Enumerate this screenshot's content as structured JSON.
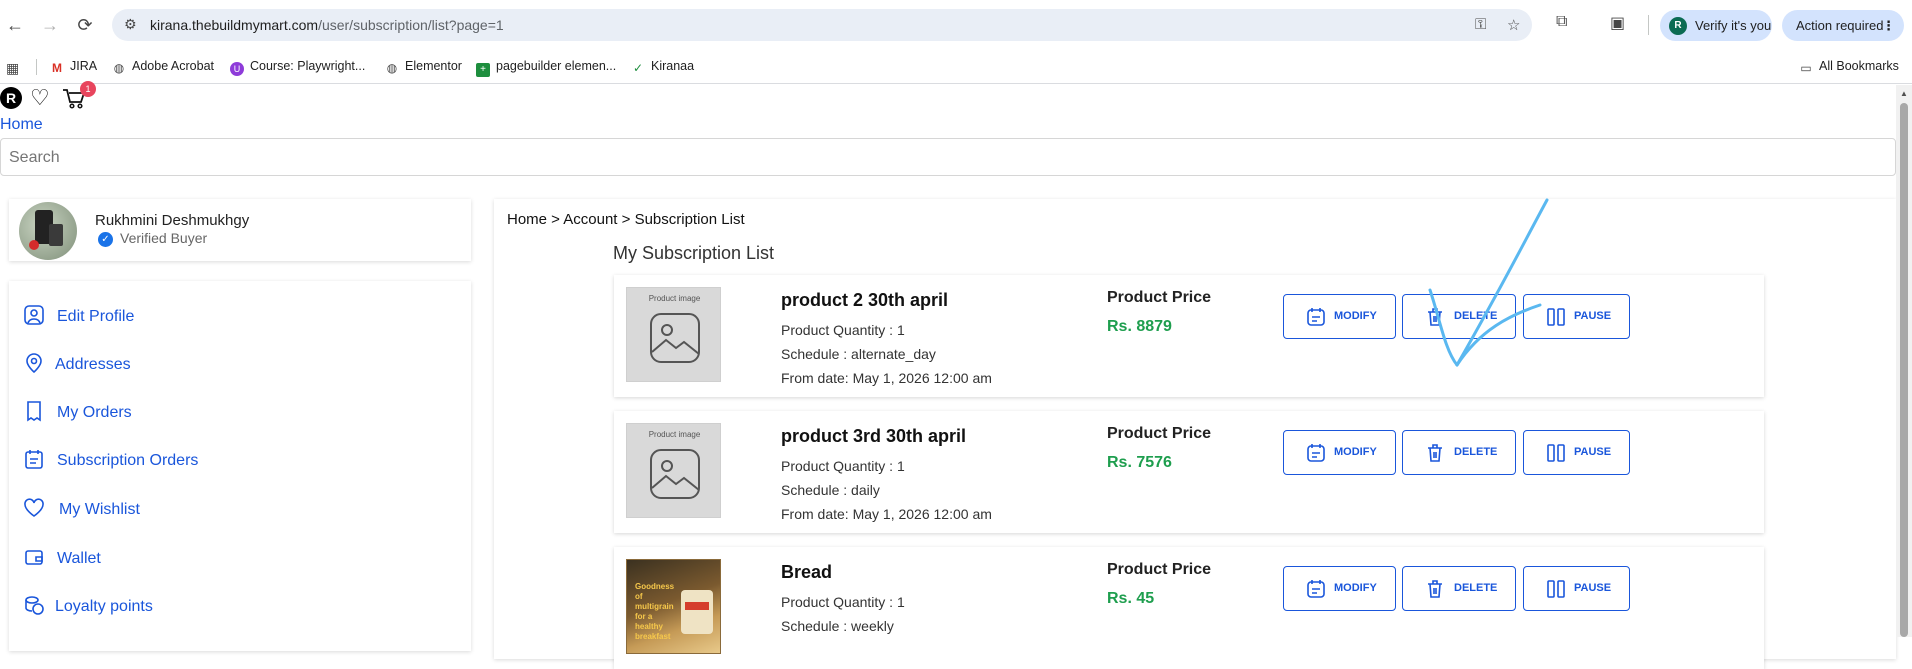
{
  "browser": {
    "url_host": "kirana.thebuildmymart.com",
    "url_path": "/user/subscription/list?page=1",
    "verify_label": "Verify it's you",
    "verify_avatar": "R",
    "action_label": "Action required",
    "bookmarks": [
      "JIRA",
      "Adobe Acrobat",
      "Course: Playwright...",
      "Elementor",
      "pagebuilder elemen...",
      "Kiranaa"
    ],
    "all_bookmarks": "All Bookmarks"
  },
  "header": {
    "user_initial": "R",
    "cart_count": "1",
    "home_link": "Home",
    "search_placeholder": "Search"
  },
  "profile": {
    "name": "Rukhmini Deshmukhgy",
    "status": "Verified Buyer"
  },
  "sidebar": {
    "items": [
      {
        "label": "Edit Profile",
        "icon": "user-icon"
      },
      {
        "label": "Addresses",
        "icon": "location-pin-icon"
      },
      {
        "label": "My Orders",
        "icon": "receipt-icon"
      },
      {
        "label": "Subscription Orders",
        "icon": "calendar-list-icon"
      },
      {
        "label": "My Wishlist",
        "icon": "heart-icon"
      },
      {
        "label": "Wallet",
        "icon": "wallet-icon"
      },
      {
        "label": "Loyalty points",
        "icon": "coins-icon"
      }
    ]
  },
  "main": {
    "breadcrumb": "Home > Account > Subscription List",
    "title": "My Subscription List",
    "price_label": "Product Price",
    "buttons": {
      "modify": "MODIFY",
      "delete": "DELETE",
      "pause": "PAUSE"
    },
    "subscriptions": [
      {
        "name": "product 2 30th april",
        "quantity": "Product Quantity : 1",
        "schedule": "Schedule : alternate_day",
        "from_date": "From date: May 1, 2026 12:00 am",
        "price": "Rs. 8879",
        "image_caption": "Product image"
      },
      {
        "name": "product 3rd 30th april",
        "quantity": "Product Quantity : 1",
        "schedule": "Schedule : daily",
        "from_date": "From date: May 1, 2026 12:00 am",
        "price": "Rs. 7576",
        "image_caption": "Product image"
      },
      {
        "name": "Bread",
        "quantity": "Product Quantity : 1",
        "schedule": "Schedule : weekly",
        "price": "Rs. 45",
        "image_caption": "Goodness of multigrain for a healthy breakfast"
      }
    ]
  },
  "colors": {
    "accent": "#1a56db",
    "price": "#1e9e4e",
    "annotation": "#5ab8f0"
  }
}
